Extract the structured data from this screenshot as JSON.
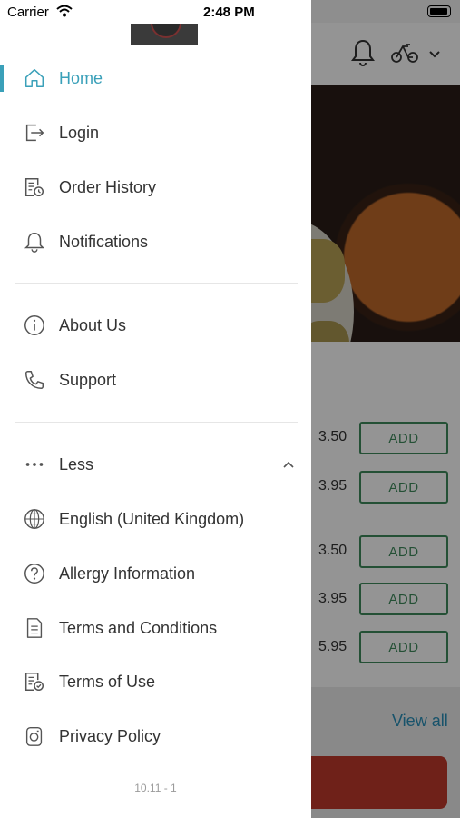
{
  "status_bar": {
    "carrier": "Carrier",
    "time": "2:48 PM"
  },
  "background": {
    "items": [
      {
        "price": "3.50",
        "button": "ADD"
      },
      {
        "price": "3.95",
        "button": "ADD"
      },
      {
        "price": "3.50",
        "button": "ADD"
      },
      {
        "price": "3.95",
        "button": "ADD"
      },
      {
        "price": "5.95",
        "button": "ADD"
      }
    ],
    "view_all": "View all"
  },
  "menu": {
    "primary": [
      {
        "label": "Home",
        "icon": "home-icon",
        "active": true
      },
      {
        "label": "Login",
        "icon": "login-icon"
      },
      {
        "label": "Order History",
        "icon": "order-history-icon"
      },
      {
        "label": "Notifications",
        "icon": "bell-icon"
      }
    ],
    "secondary": [
      {
        "label": "About Us",
        "icon": "info-icon"
      },
      {
        "label": "Support",
        "icon": "phone-icon"
      }
    ],
    "less_label": "Less",
    "more": [
      {
        "label": "English (United Kingdom)",
        "icon": "globe-icon"
      },
      {
        "label": "Allergy Information",
        "icon": "question-icon"
      },
      {
        "label": "Terms and Conditions",
        "icon": "document-icon"
      },
      {
        "label": "Terms of Use",
        "icon": "document-check-icon"
      },
      {
        "label": "Privacy Policy",
        "icon": "privacy-icon"
      }
    ]
  },
  "version": "10.11 - 1",
  "colors": {
    "accent": "#3aa0b9",
    "add_green": "#3e8a5c",
    "link_blue": "#2a8fb8"
  }
}
